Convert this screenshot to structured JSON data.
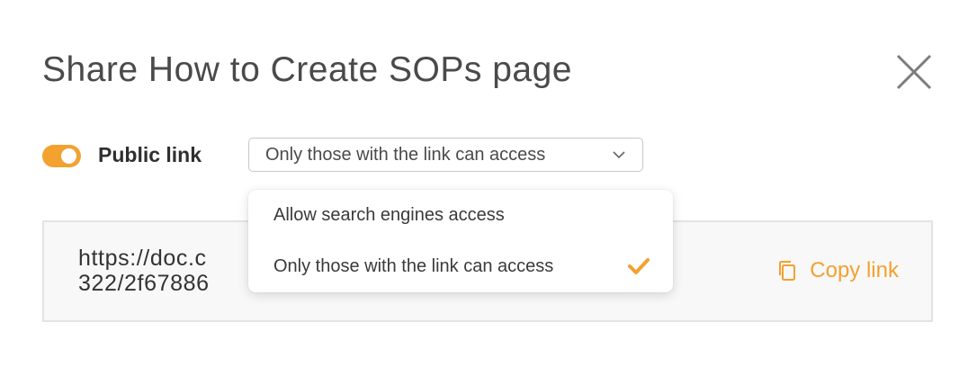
{
  "dialog": {
    "title": "Share How to Create SOPs page"
  },
  "public_link": {
    "label": "Public link",
    "enabled": true
  },
  "access_select": {
    "selected": "Only those with the link can access",
    "options": [
      {
        "label": "Allow search engines access",
        "selected": false
      },
      {
        "label": "Only those with the link can access",
        "selected": true
      }
    ]
  },
  "link": {
    "url_line1": "https://doc.c",
    "url_line2": "322/2f67886",
    "copy_label": "Copy link"
  },
  "colors": {
    "accent": "#f3a12f"
  }
}
